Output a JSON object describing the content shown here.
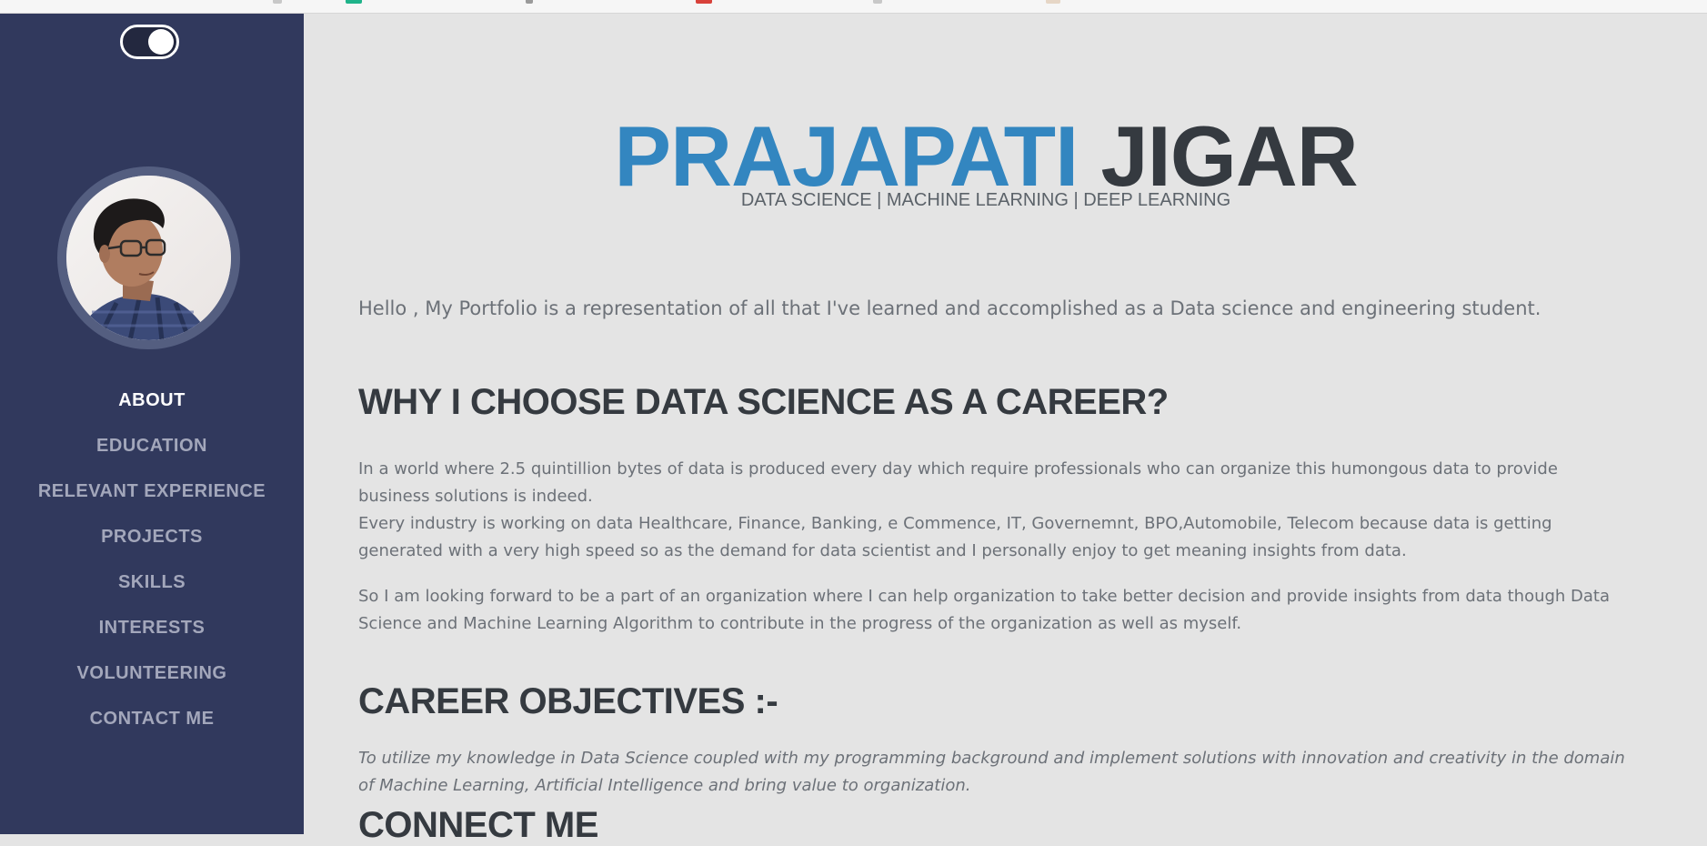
{
  "sidebar": {
    "theme_toggle_state": "on",
    "avatar_alt": "Profile photo",
    "nav": [
      {
        "label": "ABOUT",
        "active": true
      },
      {
        "label": "EDUCATION",
        "active": false
      },
      {
        "label": "RELEVANT EXPERIENCE",
        "active": false
      },
      {
        "label": "PROJECTS",
        "active": false
      },
      {
        "label": "SKILLS",
        "active": false
      },
      {
        "label": "INTERESTS",
        "active": false
      },
      {
        "label": "VOLUNTEERING",
        "active": false
      },
      {
        "label": "CONTACT ME",
        "active": false
      }
    ]
  },
  "main": {
    "name_first": "PRAJAPATI",
    "name_last": "JIGAR",
    "subheading": "DATA SCIENCE | MACHINE LEARNING | DEEP LEARNING",
    "intro": "Hello , My Portfolio is a representation of all that I've learned and accomplished as a Data science and engineering student.",
    "why_heading": "WHY I CHOOSE DATA SCIENCE AS A CAREER?",
    "why_p1": "In a world where 2.5 quintillion bytes of data is produced every day which require professionals who can organize this humongous data to provide business solutions is indeed.",
    "why_p2": "Every industry is working on data Healthcare, Finance, Banking, e Commence, IT, Governemnt, BPO,Automobile, Telecom because data is getting generated with a very high speed so as the demand for data scientist and I personally enjoy to get meaning insights from data.",
    "why_p3": "So I am looking forward to be a part of an organization where I can help organization to take better decision and provide insights from data though Data Science and Machine Learning Algorithm to contribute in the progress of the organization as well as myself.",
    "objectives_heading": "CAREER OBJECTIVES :-",
    "objectives_text": "To utilize my knowledge in Data Science coupled with my programming background and implement solutions with innovation and creativity in the domain of Machine Learning, Artificial Intelligence and bring value to organization.",
    "connect_heading": "CONNECT ME"
  },
  "colors": {
    "sidebar_bg": "#31395d",
    "accent_blue": "#3386c0",
    "heading_dark": "#353a40",
    "body_text": "#6c7178",
    "page_bg": "#e4e4e4"
  }
}
